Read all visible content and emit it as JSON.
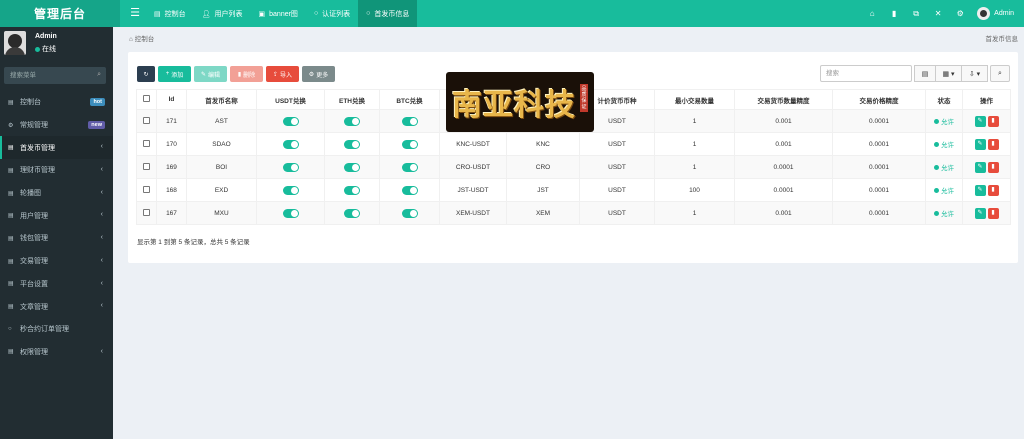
{
  "app": {
    "title": "管理后台"
  },
  "topnav": {
    "tabs": [
      {
        "label": "控制台",
        "icon": "dashboard-icon",
        "active": false
      },
      {
        "label": "用户列表",
        "icon": "user-icon",
        "active": false
      },
      {
        "label": "banner图",
        "icon": "image-icon",
        "active": false
      },
      {
        "label": "认证列表",
        "icon": "circle-icon",
        "active": false
      },
      {
        "label": "首发币信息",
        "icon": "circle-icon",
        "active": true
      }
    ],
    "user": "Admin"
  },
  "sidebar": {
    "user": {
      "name": "Admin",
      "status": "在线"
    },
    "search_placeholder": "搜索菜单",
    "items": [
      {
        "label": "控制台",
        "badge": "hot",
        "badge_color": "#3c8dbc"
      },
      {
        "label": "常规管理",
        "badge": "new",
        "badge_color": "#605ca8"
      },
      {
        "label": "首发币管理",
        "active": true,
        "arrow": "‹"
      },
      {
        "label": "理财币管理",
        "arrow": "‹"
      },
      {
        "label": "轮播图",
        "arrow": "‹"
      },
      {
        "label": "用户管理",
        "arrow": "‹"
      },
      {
        "label": "钱包管理",
        "arrow": "‹"
      },
      {
        "label": "交易管理",
        "arrow": "‹"
      },
      {
        "label": "平台设置",
        "arrow": "‹"
      },
      {
        "label": "文章管理",
        "arrow": "‹"
      },
      {
        "label": "秒合约订单管理"
      },
      {
        "label": "权限管理",
        "arrow": "‹"
      }
    ]
  },
  "breadcrumb": {
    "home": "控制台",
    "current": "首发币信息"
  },
  "toolbar": {
    "add": "添加",
    "edit": "编辑",
    "delete": "删除",
    "import": "导入",
    "more": "更多",
    "search_placeholder": "搜索"
  },
  "table": {
    "columns": [
      "",
      "Id",
      "首发币名称",
      "USDT兑换",
      "ETH兑换",
      "BTC兑换",
      "",
      "",
      "计价货币币种",
      "最小交易数量",
      "交易货币数量精度",
      "交易价格精度",
      "状态",
      "操作"
    ],
    "rows": [
      {
        "id": "171",
        "name": "AST",
        "pair": "",
        "base": "",
        "quote": "USDT",
        "min": "1",
        "qty_prec": "0.001",
        "price_prec": "0.0001",
        "status": "允许"
      },
      {
        "id": "170",
        "name": "SDAO",
        "pair": "KNC-USDT",
        "base": "KNC",
        "quote": "USDT",
        "min": "1",
        "qty_prec": "0.001",
        "price_prec": "0.0001",
        "status": "允许"
      },
      {
        "id": "169",
        "name": "BOI",
        "pair": "CRO-USDT",
        "base": "CRO",
        "quote": "USDT",
        "min": "1",
        "qty_prec": "0.0001",
        "price_prec": "0.0001",
        "status": "允许"
      },
      {
        "id": "168",
        "name": "EXD",
        "pair": "JST-USDT",
        "base": "JST",
        "quote": "USDT",
        "min": "100",
        "qty_prec": "0.0001",
        "price_prec": "0.0001",
        "status": "允许"
      },
      {
        "id": "167",
        "name": "MXU",
        "pair": "XEM-USDT",
        "base": "XEM",
        "quote": "USDT",
        "min": "1",
        "qty_prec": "0.001",
        "price_prec": "0.0001",
        "status": "允许"
      }
    ]
  },
  "summary": "显示第 1 到第 5 条记录，总共 5 条记录",
  "watermark": {
    "text": "南亚科技",
    "tag": "品质保证"
  }
}
